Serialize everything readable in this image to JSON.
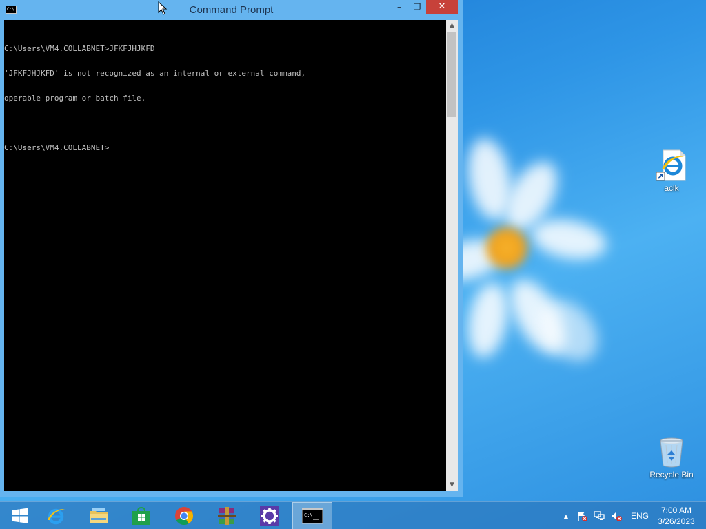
{
  "window": {
    "title": "Command Prompt",
    "icon_text": "C:\\",
    "minimize_glyph": "–",
    "maximize_glyph": "❐",
    "close_glyph": "✕"
  },
  "console": {
    "lines": [
      "C:\\Users\\VM4.COLLABNET>JFKFJHJKFD",
      "'JFKFJHJKFD' is not recognized as an internal or external command,",
      "operable program or batch file.",
      "",
      "C:\\Users\\VM4.COLLABNET>"
    ]
  },
  "scrollbar": {
    "up_glyph": "▲",
    "down_glyph": "▼"
  },
  "desktop": {
    "icons": [
      {
        "label": "aclk",
        "icon": "internet-explorer-shortcut-icon"
      },
      {
        "label": "Recycle Bin",
        "icon": "recycle-bin-icon"
      }
    ]
  },
  "taskbar": {
    "items": [
      {
        "name": "start",
        "icon": "windows-logo-icon"
      },
      {
        "name": "internet-explorer",
        "icon": "internet-explorer-icon"
      },
      {
        "name": "file-explorer",
        "icon": "folder-icon"
      },
      {
        "name": "store",
        "icon": "store-icon"
      },
      {
        "name": "chrome",
        "icon": "chrome-icon"
      },
      {
        "name": "winrar",
        "icon": "winrar-icon"
      },
      {
        "name": "settings",
        "icon": "gear-icon"
      },
      {
        "name": "command-prompt",
        "icon": "terminal-icon",
        "active": true
      }
    ],
    "tray": {
      "chevron": "▲",
      "language": "ENG",
      "time": "7:00 AM",
      "date": "3/26/2023"
    }
  },
  "colors": {
    "close_button": "#c7413a",
    "titlebar": "#65b4ef",
    "console_bg": "#000000",
    "console_text": "#c0c0c0"
  }
}
